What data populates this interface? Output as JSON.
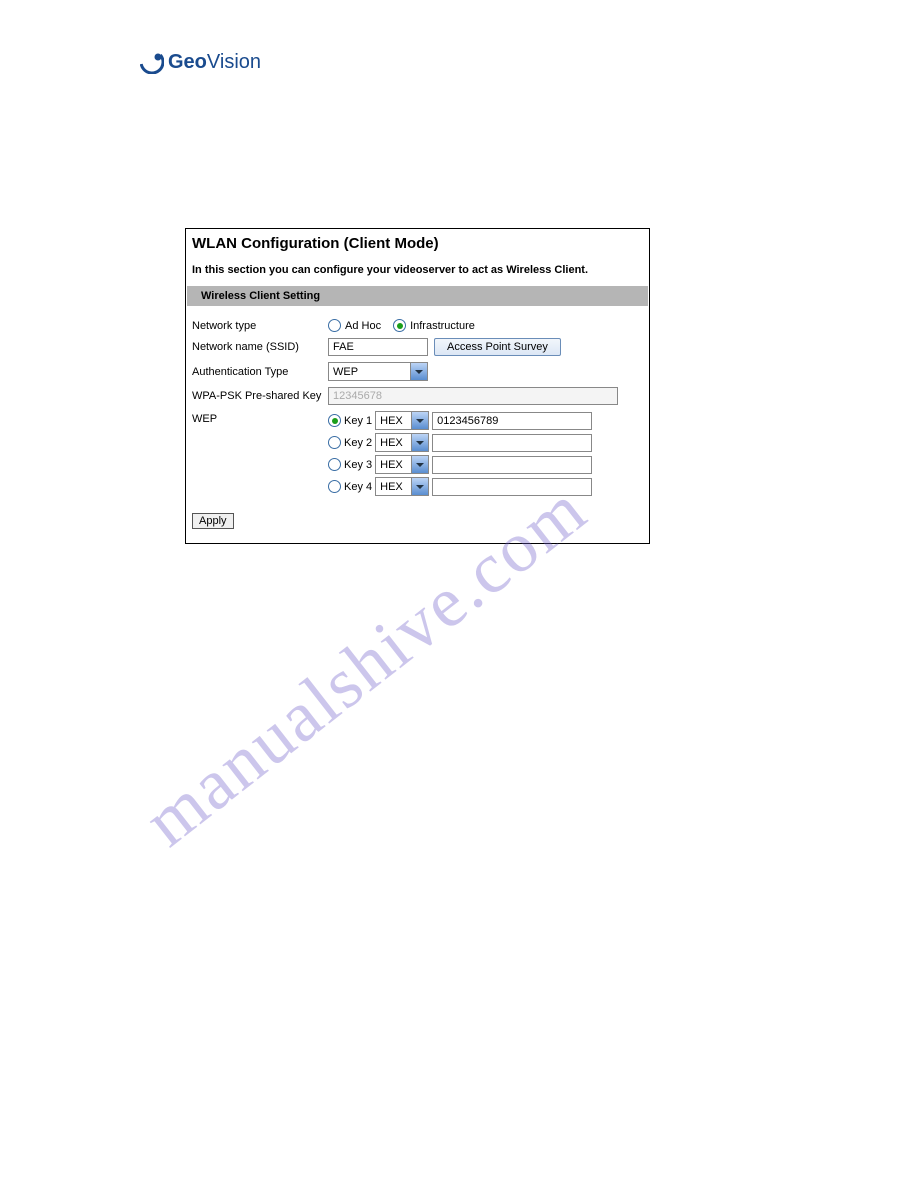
{
  "brand": {
    "geo": "Geo",
    "vision": "Vision"
  },
  "panel": {
    "title": "WLAN Configuration (Client Mode)",
    "desc": "In this section you can configure your videoserver to act as Wireless Client.",
    "section_header": "Wireless Client Setting"
  },
  "labels": {
    "network_type": "Network type",
    "network_name": "Network name (SSID)",
    "auth_type": "Authentication Type",
    "wpa_psk": "WPA-PSK Pre-shared Key",
    "wep": "WEP"
  },
  "fields": {
    "network_type": {
      "adhoc_label": "Ad Hoc",
      "infra_label": "Infrastructure",
      "selected": "infrastructure"
    },
    "ssid": {
      "value": "FAE",
      "survey_button": "Access Point Survey"
    },
    "auth": {
      "value": "WEP"
    },
    "wpa_psk": {
      "value": "12345678"
    },
    "wep": {
      "selected": 0,
      "keys": [
        {
          "label": "Key 1",
          "format": "HEX",
          "value": "0123456789"
        },
        {
          "label": "Key 2",
          "format": "HEX",
          "value": ""
        },
        {
          "label": "Key 3",
          "format": "HEX",
          "value": ""
        },
        {
          "label": "Key 4",
          "format": "HEX",
          "value": ""
        }
      ]
    }
  },
  "apply_label": "Apply",
  "watermark": "manualshive.com"
}
